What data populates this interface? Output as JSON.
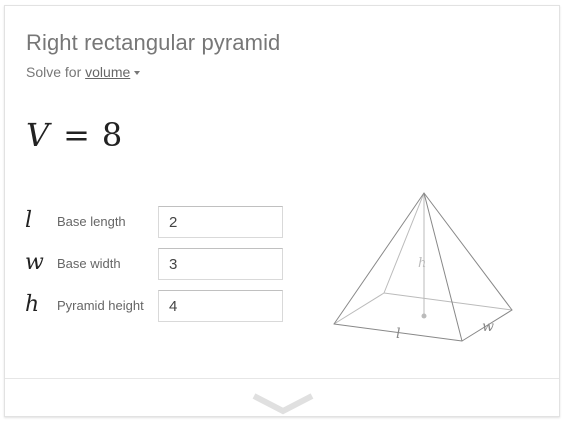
{
  "card": {
    "title": "Right rectangular pyramid",
    "solve_prefix": "Solve for",
    "solve_target": "volume",
    "result": {
      "variable": "V",
      "equals": "=",
      "value": "8"
    }
  },
  "fields": [
    {
      "symbol": "l",
      "label": "Base length",
      "value": "2"
    },
    {
      "symbol": "w",
      "label": "Base width",
      "value": "3"
    },
    {
      "symbol": "h",
      "label": "Pyramid height",
      "value": "4"
    }
  ],
  "diagram": {
    "height_label": "h",
    "length_label": "l",
    "width_label": "w"
  },
  "icons": {
    "solve_dropdown": "caret-down-icon",
    "expand": "chevron-down-icon"
  },
  "colors": {
    "title": "#777777",
    "text": "#222222",
    "diagram": "#888888",
    "diagram_hidden": "#bbbbbb"
  }
}
